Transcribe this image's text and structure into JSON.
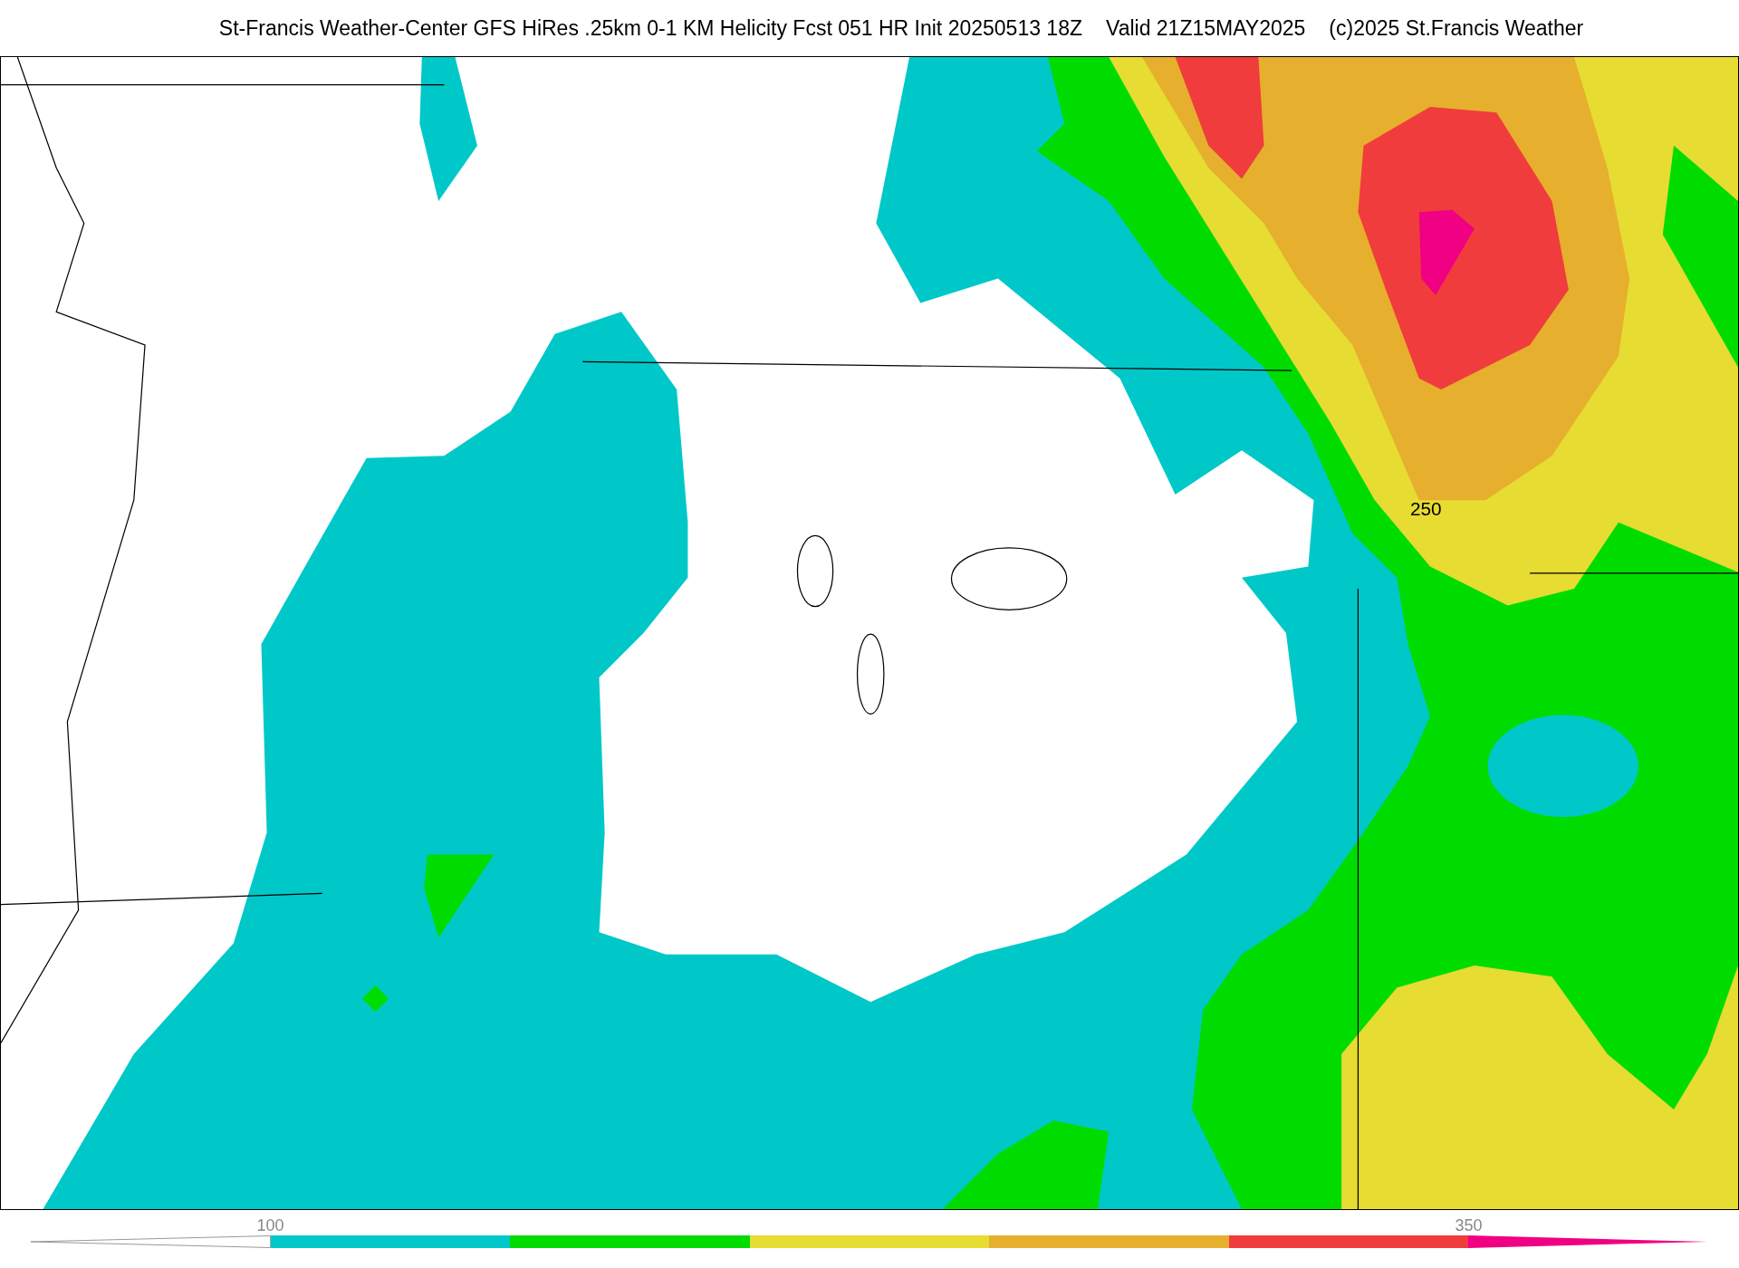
{
  "title": {
    "main": "St-Francis Weather-Center GFS HiRes .25km 0-1 KM Helicity Fcst 051 HR Init 20250513 18Z",
    "valid": "Valid 21Z15MAY2025",
    "credit": "(c)2025 St.Francis Weather"
  },
  "map": {
    "contour_label": "250"
  },
  "colorbar": {
    "bins": [
      {
        "kind": "arrow-left"
      },
      {
        "kind": "bar",
        "color": "#00c8c8",
        "tick": "100"
      },
      {
        "kind": "bar",
        "color": "#00dc00"
      },
      {
        "kind": "bar",
        "color": "#e6dc32"
      },
      {
        "kind": "bar",
        "color": "#e6af2d"
      },
      {
        "kind": "bar",
        "color": "#f03c3c"
      },
      {
        "kind": "arrow-right",
        "color": "#f00082",
        "tick": "350"
      }
    ]
  }
}
